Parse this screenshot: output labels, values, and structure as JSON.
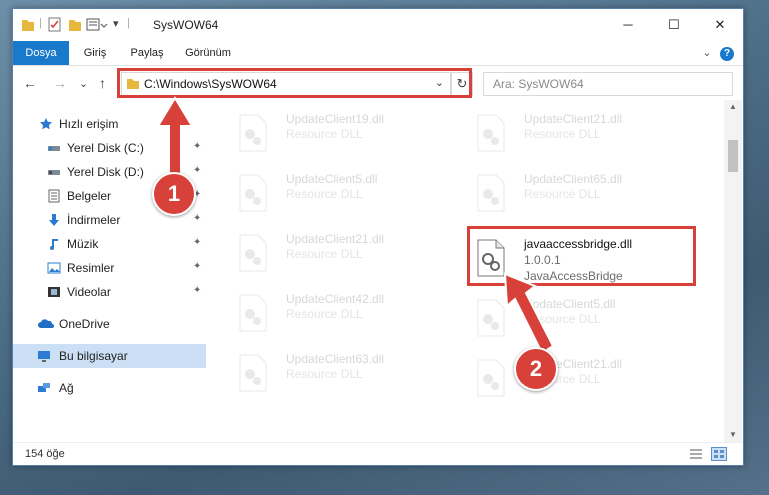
{
  "window": {
    "title": "SysWOW64",
    "minimize": "─",
    "maximize": "☐",
    "close": "✕"
  },
  "ribbon": {
    "tabs": [
      "Dosya",
      "Giriş",
      "Paylaş",
      "Görünüm"
    ],
    "expand": "⌄",
    "help": "?"
  },
  "nav": {
    "back": "←",
    "forward": "→",
    "recent": "⌄",
    "up": "↑",
    "path": "C:\\Windows\\SysWOW64",
    "dropdown": "⌄",
    "refresh": "↻",
    "search_placeholder": "Ara: SysWOW64"
  },
  "sidebar": {
    "items": [
      {
        "label": "Hızlı erişim",
        "icon": "star-icon",
        "pinned": false
      },
      {
        "label": "Yerel Disk (C:)",
        "icon": "drive-icon",
        "pinned": true
      },
      {
        "label": "Yerel Disk (D:)",
        "icon": "drive-icon",
        "pinned": true
      },
      {
        "label": "Belgeler",
        "icon": "documents-icon",
        "pinned": true
      },
      {
        "label": "İndirmeler",
        "icon": "download-icon",
        "pinned": true
      },
      {
        "label": "Müzik",
        "icon": "music-icon",
        "pinned": true
      },
      {
        "label": "Resimler",
        "icon": "pictures-icon",
        "pinned": true
      },
      {
        "label": "Videolar",
        "icon": "videos-icon",
        "pinned": true
      },
      {
        "label": "OneDrive",
        "icon": "cloud-icon",
        "pinned": false
      },
      {
        "label": "Bu bilgisayar",
        "icon": "computer-icon",
        "pinned": false,
        "selected": true
      },
      {
        "label": "Ağ",
        "icon": "network-icon",
        "pinned": false
      }
    ],
    "pin_glyph": "📌"
  },
  "files": {
    "left": [
      {
        "name": "UpdateClient19.dll",
        "type": "Resource DLL"
      },
      {
        "name": "UpdateClient5.dll",
        "type": "Resource DLL"
      },
      {
        "name": "UpdateClient21.dll",
        "type": "Resource DLL"
      },
      {
        "name": "UpdateClient42.dll",
        "type": "Resource DLL"
      },
      {
        "name": "UpdateClient63.dll",
        "type": "Resource DLL"
      }
    ],
    "right": [
      {
        "name": "UpdateClient21.dll",
        "type": "Resource DLL"
      },
      {
        "name": "UpdateClient65.dll",
        "type": "Resource DLL"
      },
      {
        "name": "javaaccessbridge.dll",
        "version": "1.0.0.1",
        "type": "JavaAccessBridge",
        "highlight": true
      },
      {
        "name": "UpdateClient5.dll",
        "type": "Resource DLL"
      },
      {
        "name": "UpdateClient21.dll",
        "type": "Resource DLL"
      }
    ]
  },
  "status": {
    "count": "154 öğe"
  },
  "annotations": {
    "step1": "1",
    "step2": "2",
    "color": "#d8413a"
  }
}
